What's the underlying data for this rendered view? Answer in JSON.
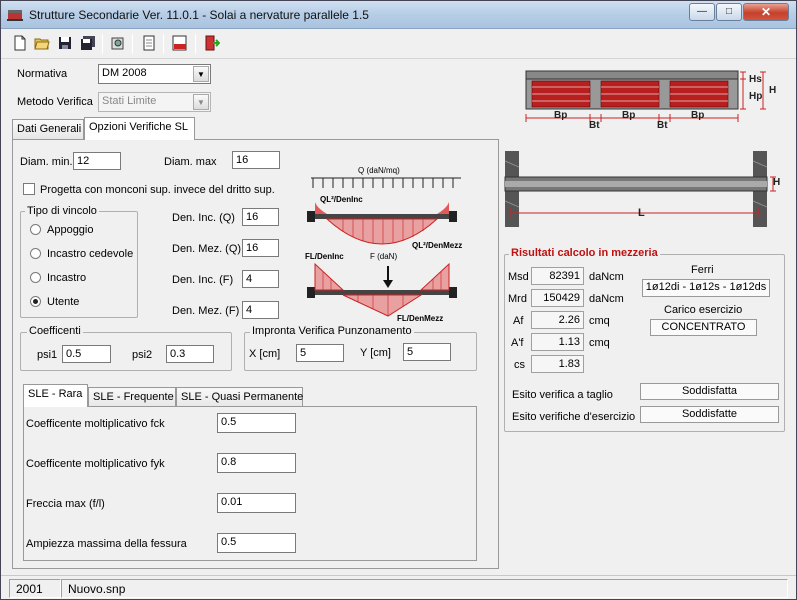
{
  "window": {
    "title": "Strutture Secondarie Ver. 11.0.1 - Solai a nervature parallele 1.5",
    "min": "—",
    "max": "□",
    "close": "✕"
  },
  "toolbar": {
    "icons": [
      "new-icon",
      "open-icon",
      "save-icon",
      "save-all-icon",
      "settings-icon",
      "print-preview-icon",
      "pdf-icon",
      "exit-icon"
    ]
  },
  "header": {
    "normativa_label": "Normativa",
    "normativa_value": "DM 2008",
    "metodo_label": "Metodo Verifica",
    "metodo_value": "Stati Limite"
  },
  "tabs": {
    "dati_generali": "Dati Generali",
    "opzioni": "Opzioni Verifiche SL"
  },
  "diam": {
    "min_label": "Diam. min.",
    "min_value": "12",
    "max_label": "Diam. max",
    "max_value": "16"
  },
  "monconi_label": "Progetta con monconi sup. invece del dritto sup.",
  "vincolo": {
    "title": "Tipo di vincolo",
    "options": [
      "Appoggio",
      "Incastro cedevole",
      "Incastro",
      "Utente"
    ],
    "selected": "Utente"
  },
  "den": {
    "inc_q_label": "Den. Inc. (Q)",
    "inc_q": "16",
    "mez_q_label": "Den. Mez. (Q)",
    "mez_q": "16",
    "inc_f_label": "Den. Inc. (F)",
    "inc_f": "4",
    "mez_f_label": "Den. Mez. (F)",
    "mez_f": "4"
  },
  "diagram": {
    "q_label": "Q (daN/mq)",
    "ql_deninc": "QL²/DenInc",
    "ql_denmezz": "QL²/DenMezz",
    "fl_deninc": "FL/DenInc",
    "f_label": "F (daN)",
    "fl_denmezz": "FL/DenMezz"
  },
  "coeff": {
    "title": "Coefficenti",
    "psi1_label": "psi1",
    "psi1": "0.5",
    "psi2_label": "psi2",
    "psi2": "0.3"
  },
  "impronta": {
    "title": "Impronta Verifica  Punzonamento",
    "x_label": "X [cm]",
    "x": "5",
    "y_label": "Y [cm]",
    "y": "5"
  },
  "sle_tabs": [
    "SLE - Rara",
    "SLE - Frequente",
    "SLE - Quasi Permanente"
  ],
  "sle": {
    "fck_label": "Coefficente moltiplicativo fck",
    "fck": "0.5",
    "fyk_label": "Coefficente moltiplicativo fyk",
    "fyk": "0.8",
    "freccia_label": "Freccia max (f/l)",
    "freccia": "0.01",
    "fessura_label": "Ampiezza massima della fessura",
    "fessura": "0.5"
  },
  "section": {
    "hs": "Hs",
    "hp": "Hp",
    "h": "H",
    "bp": "Bp",
    "bt": "Bt",
    "h2": "H",
    "l": "L"
  },
  "risultati": {
    "title": "Risultati calcolo in mezzeria",
    "msd_label": "Msd",
    "msd": "82391",
    "msd_unit": "daNcm",
    "mrd_label": "Mrd",
    "mrd": "150429",
    "mrd_unit": "daNcm",
    "af_label": "Af",
    "af": "2.26",
    "af_unit": "cmq",
    "a1f_label": "A'f",
    "a1f": "1.13",
    "a1f_unit": "cmq",
    "cs_label": "cs",
    "cs": "1.83",
    "ferri_label": "Ferri",
    "ferri": "1ø12di - 1ø12s - 1ø12ds",
    "carico_label": "Carico esercizio",
    "carico": "CONCENTRATO",
    "taglio_label": "Esito verifica a taglio",
    "taglio": "Soddisfatta",
    "esercizio_label": "Esito verifiche d'esercizio",
    "esercizio": "Soddisfatte"
  },
  "status": {
    "code": "2001",
    "file": "Nuovo.snp"
  }
}
